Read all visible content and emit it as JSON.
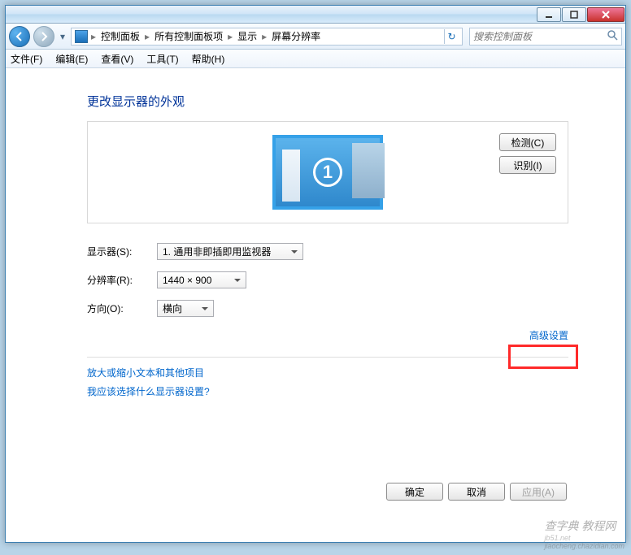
{
  "titlebar": {
    "minimize": "minimize",
    "maximize": "maximize",
    "close": "close"
  },
  "breadcrumb": {
    "items": [
      "控制面板",
      "所有控制面板项",
      "显示",
      "屏幕分辨率"
    ]
  },
  "search": {
    "placeholder": "搜索控制面板"
  },
  "menu": {
    "file": "文件(F)",
    "edit": "编辑(E)",
    "view": "查看(V)",
    "tools": "工具(T)",
    "help": "帮助(H)"
  },
  "heading": "更改显示器的外观",
  "preview": {
    "monitor_number": "1"
  },
  "side_buttons": {
    "detect": "检测(C)",
    "identify": "识别(I)"
  },
  "form": {
    "display_label": "显示器(S):",
    "display_value": "1. 通用非即插即用监视器",
    "resolution_label": "分辨率(R):",
    "resolution_value": "1440 × 900",
    "orientation_label": "方向(O):",
    "orientation_value": "横向"
  },
  "advanced_link": "高级设置",
  "links": {
    "text_size": "放大或缩小文本和其他项目",
    "which_settings": "我应该选择什么显示器设置?"
  },
  "footer": {
    "ok": "确定",
    "cancel": "取消",
    "apply": "应用(A)"
  },
  "watermark": {
    "main": "查字典   教程网",
    "sub1": "jb51.net",
    "sub2": "jiaocheng.chazidian.com"
  }
}
